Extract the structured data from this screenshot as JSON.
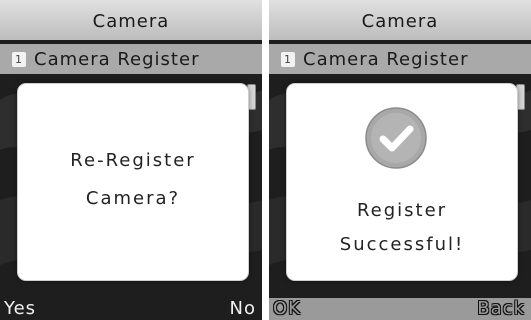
{
  "screens": [
    {
      "title": "Camera",
      "menu_item": {
        "number": "1",
        "label": "Camera Register"
      },
      "dialog": {
        "lines": [
          "Re-Register",
          "Camera?"
        ]
      },
      "softkeys": {
        "left": "Yes",
        "right": "No"
      }
    },
    {
      "title": "Camera",
      "menu_item": {
        "number": "1",
        "label": "Camera Register"
      },
      "dialog": {
        "icon": "check-circle-icon",
        "lines": [
          "Register",
          "Successful!"
        ]
      },
      "softkeys": {
        "left": "OK",
        "right": "Back"
      }
    }
  ],
  "colors": {
    "screen_background": "#1e1e1e",
    "title_bar": "#c8c8c8",
    "menu_bar": "#a9a9a9",
    "dialog": "#ffffff",
    "check_circle": "#a8a8a8",
    "softkey_bar_light": "#9a9a9a"
  }
}
